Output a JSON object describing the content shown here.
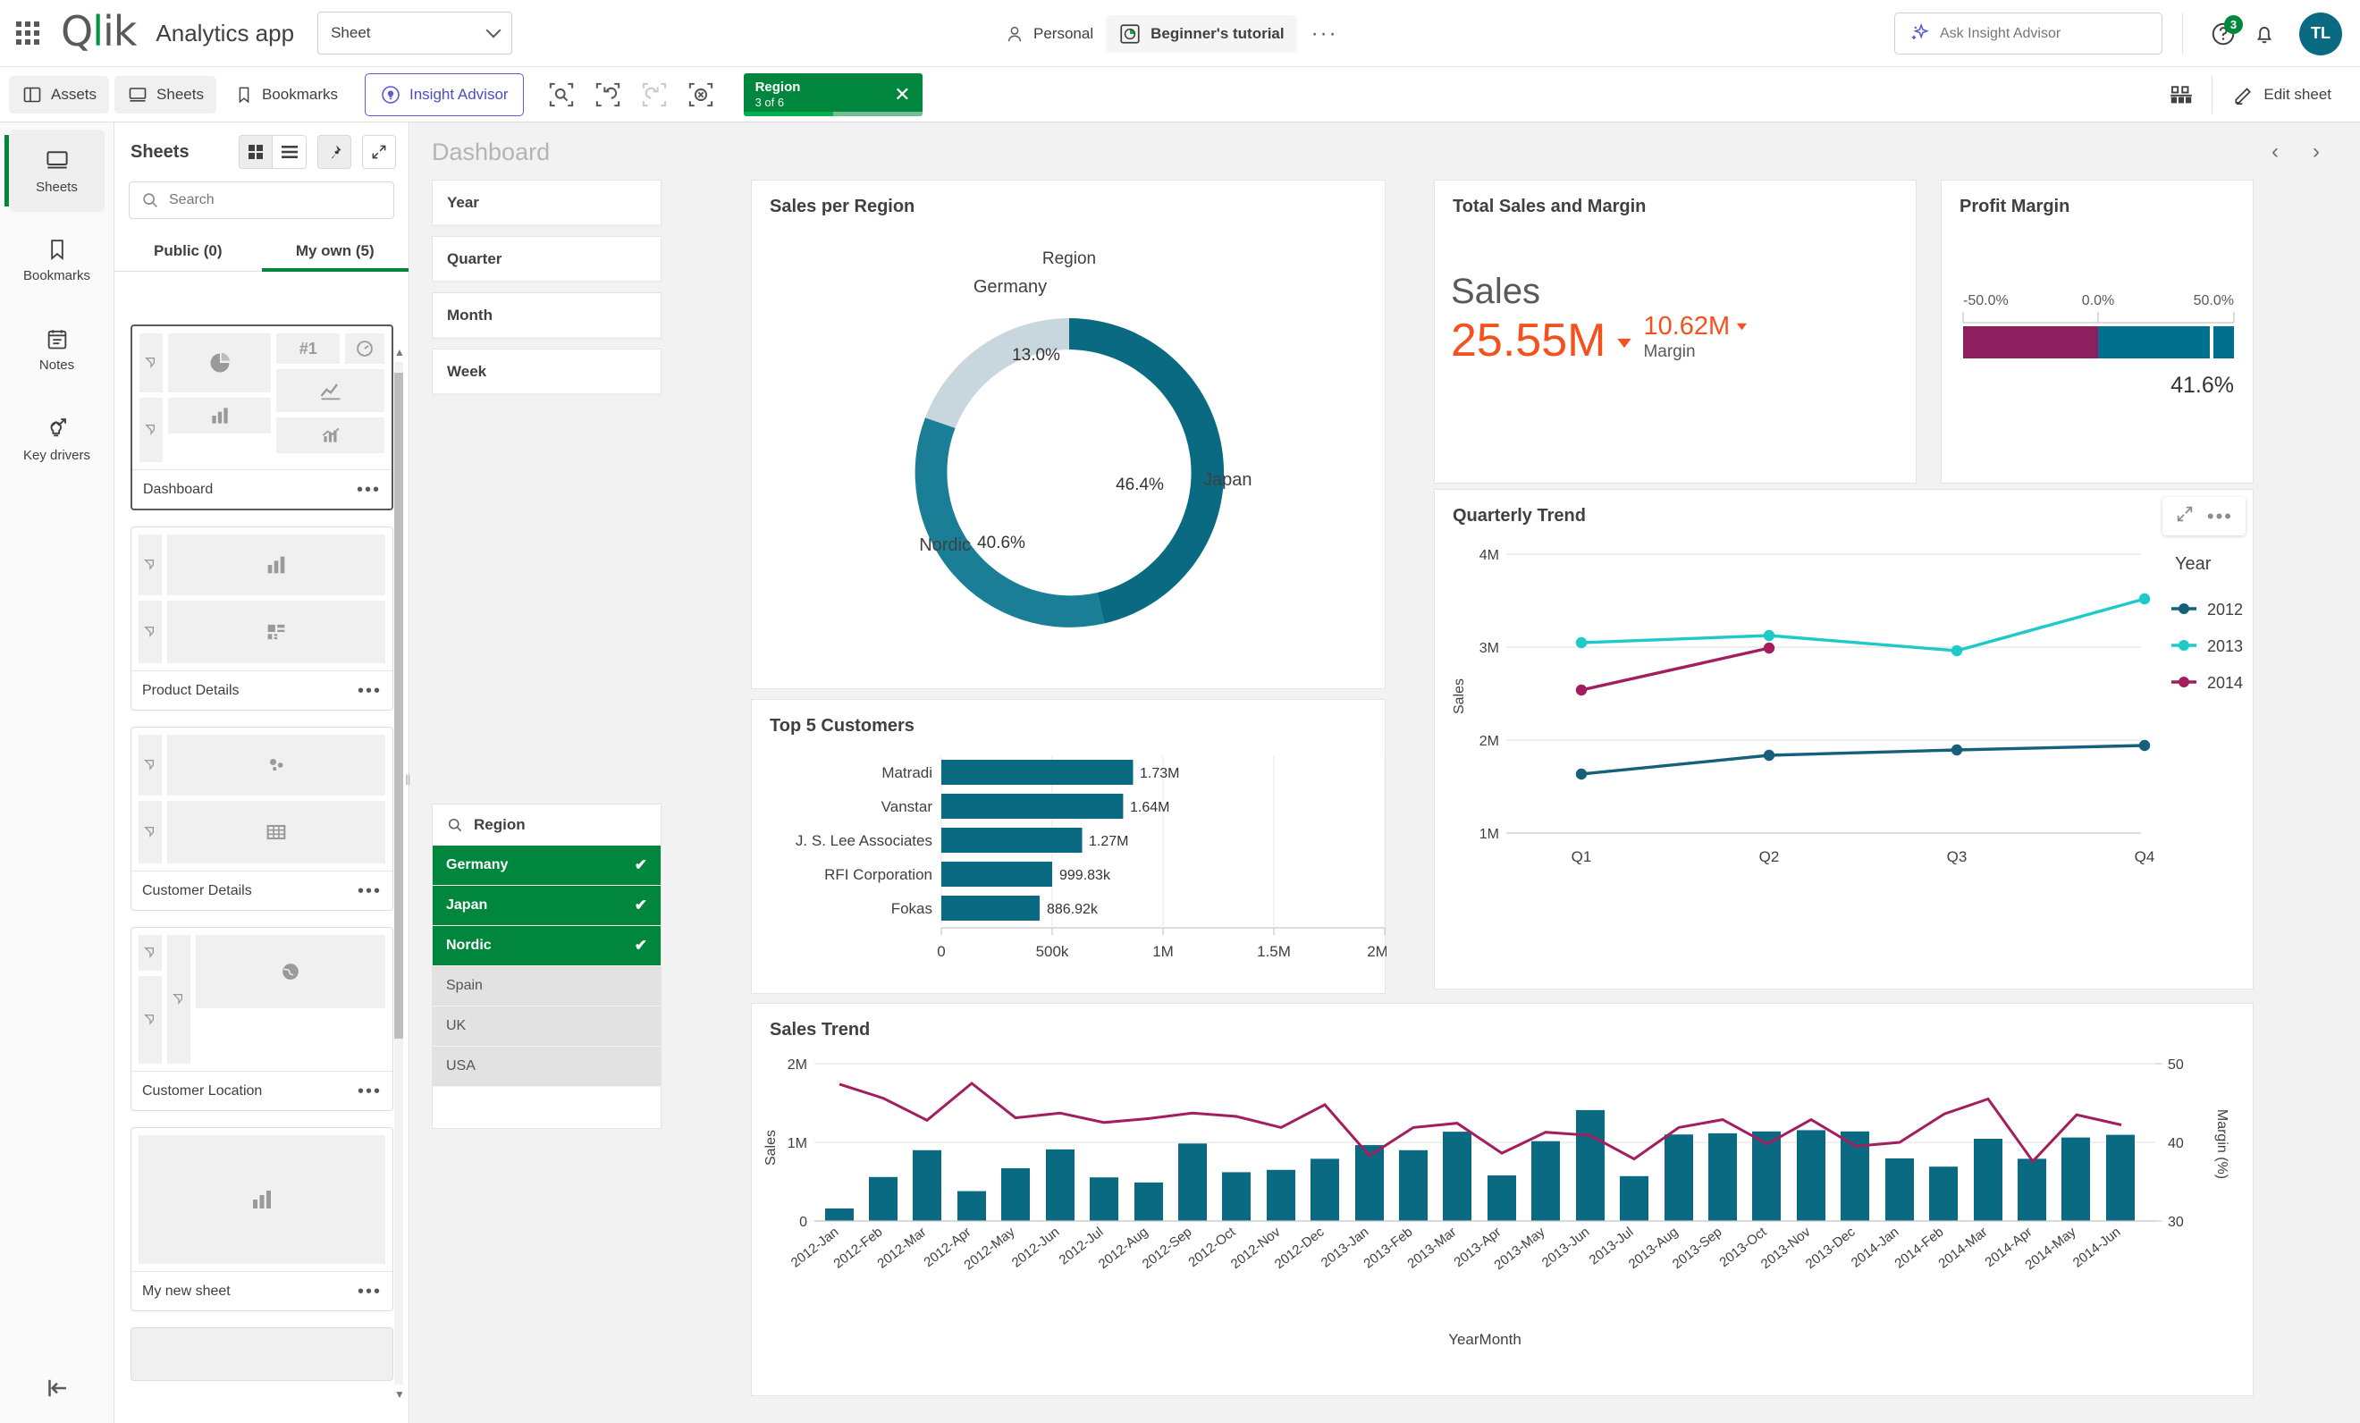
{
  "header": {
    "waffle_icon": "grid-apps-icon",
    "logo": "Qlik",
    "app_title": "Analytics app",
    "sheet_selector_label": "Sheet",
    "space_label": "Personal",
    "app_name": "Beginner's tutorial",
    "more_label": "···",
    "ask_placeholder": "Ask Insight Advisor",
    "help_badge": "3",
    "avatar_initials": "TL"
  },
  "toolbar": {
    "assets": "Assets",
    "sheets": "Sheets",
    "bookmarks": "Bookmarks",
    "insight_advisor": "Insight Advisor",
    "selection_chip": {
      "field": "Region",
      "state": "3 of 6",
      "close": "✕"
    },
    "sheet_view": "sheet-grid-icon",
    "edit_sheet": "Edit sheet"
  },
  "rail": {
    "items": [
      {
        "label": "Sheets",
        "icon": "sheet-icon",
        "selected": true
      },
      {
        "label": "Bookmarks",
        "icon": "bookmark-icon",
        "selected": false
      },
      {
        "label": "Notes",
        "icon": "notes-icon",
        "selected": false
      },
      {
        "label": "Key drivers",
        "icon": "key-drivers-icon",
        "selected": false
      }
    ],
    "collapse_icon": "collapse-left-icon"
  },
  "sheets_panel": {
    "title": "Sheets",
    "search_placeholder": "Search",
    "tabs": [
      {
        "label": "Public (0)",
        "active": false
      },
      {
        "label": "My own (5)",
        "active": true
      }
    ],
    "cards": [
      {
        "name": "Dashboard",
        "selected": true
      },
      {
        "name": "Product Details",
        "selected": false
      },
      {
        "name": "Customer Details",
        "selected": false
      },
      {
        "name": "Customer Location",
        "selected": false
      },
      {
        "name": "My new sheet",
        "selected": false
      }
    ]
  },
  "sheet": {
    "title": "Dashboard",
    "prev_icon": "chevron-left-icon",
    "next_icon": "chevron-right-icon"
  },
  "filters": {
    "boxes": [
      "Year",
      "Quarter",
      "Month",
      "Week"
    ],
    "listbox": {
      "field": "Region",
      "values": [
        {
          "label": "Germany",
          "state": "selected"
        },
        {
          "label": "Japan",
          "state": "selected"
        },
        {
          "label": "Nordic",
          "state": "selected"
        },
        {
          "label": "Spain",
          "state": "excluded"
        },
        {
          "label": "UK",
          "state": "excluded"
        },
        {
          "label": "USA",
          "state": "excluded"
        }
      ]
    }
  },
  "colors": {
    "teal_dark": "#0a6a82",
    "teal": "#1a7f96",
    "teal_light": "#c8d6dd",
    "magenta": "#a21e5e",
    "cyan": "#1ec9c9",
    "navy": "#15607a",
    "green": "#00873d",
    "orange": "#f4511e"
  },
  "chart_data": [
    {
      "id": "sales-per-region",
      "type": "pie",
      "title": "Sales per Region",
      "legend_title": "Region",
      "labels": [
        "Japan",
        "Nordic",
        "Germany"
      ],
      "values": [
        46.4,
        40.6,
        13.0
      ],
      "value_labels": [
        "46.4%",
        "40.6%",
        "13.0%"
      ],
      "colors": [
        "#0a6a82",
        "#1a7f96",
        "#c8d6dd"
      ],
      "donut": true
    },
    {
      "id": "total-sales-and-margin",
      "type": "kpi",
      "title": "Total Sales and Margin",
      "items": [
        {
          "label": "Sales",
          "value": "25.55M",
          "trend": "down",
          "color": "#f4511e",
          "primary": true
        },
        {
          "label": "Margin",
          "value": "10.62M",
          "trend": "down",
          "color": "#f4511e",
          "primary": false
        }
      ]
    },
    {
      "id": "profit-margin",
      "type": "bullet",
      "title": "Profit Margin",
      "axis_ticks": [
        "-50.0%",
        "0.0%",
        "50.0%"
      ],
      "axis_min": -50.0,
      "axis_max": 50.0,
      "value": 41.6,
      "value_label": "41.6%",
      "negative_segment_color": "#8e1f5e",
      "positive_segment_color": "#00708f"
    },
    {
      "id": "top-5-customers",
      "type": "bar",
      "orientation": "horizontal",
      "title": "Top 5 Customers",
      "categories": [
        "Matradi",
        "Vanstar",
        "J. S. Lee Associates",
        "RFI Corporation",
        "Fokas"
      ],
      "values": [
        1730000,
        1640000,
        1270000,
        999830,
        886920
      ],
      "value_labels": [
        "1.73M",
        "1.64M",
        "1.27M",
        "999.83k",
        "886.92k"
      ],
      "xlim": [
        0,
        2000000
      ],
      "xticks": [
        "0",
        "500k",
        "1M",
        "1.5M",
        "2M"
      ],
      "bar_color": "#0a6a82"
    },
    {
      "id": "quarterly-trend",
      "type": "line",
      "title": "Quarterly Trend",
      "xlabel": "",
      "ylabel": "Sales",
      "categories": [
        "Q1",
        "Q2",
        "Q3",
        "Q4"
      ],
      "ylim": [
        1000000,
        4000000
      ],
      "yticks": [
        "1M",
        "2M",
        "3M",
        "4M"
      ],
      "legend_title": "Year",
      "legend_position": "right",
      "series": [
        {
          "name": "2012",
          "color": "#15607a",
          "values": [
            1560000,
            1870000,
            1940000,
            1990000
          ]
        },
        {
          "name": "2013",
          "color": "#1ec9c9",
          "values": [
            3050000,
            3130000,
            2970000,
            3520000
          ]
        },
        {
          "name": "2014",
          "color": "#a21e5e",
          "values": [
            2540000,
            2990000,
            null,
            null
          ]
        }
      ]
    },
    {
      "id": "sales-trend",
      "type": "bar",
      "title": "Sales Trend",
      "xlabel": "YearMonth",
      "ylabel": "Sales",
      "y2label": "Margin (%)",
      "ylim": [
        0,
        2000000
      ],
      "yticks": [
        "0",
        "1M",
        "2M"
      ],
      "y2lim": [
        30,
        50
      ],
      "y2ticks": [
        "30",
        "40",
        "50"
      ],
      "bar_color": "#0a6a82",
      "line_color": "#a21e5e",
      "categories": [
        "2012-Jan",
        "2012-Feb",
        "2012-Mar",
        "2012-Apr",
        "2012-May",
        "2012-Jun",
        "2012-Jul",
        "2012-Aug",
        "2012-Sep",
        "2012-Oct",
        "2012-Nov",
        "2012-Dec",
        "2013-Jan",
        "2013-Feb",
        "2013-Mar",
        "2013-Apr",
        "2013-May",
        "2013-Jun",
        "2013-Jul",
        "2013-Aug",
        "2013-Sep",
        "2013-Oct",
        "2013-Nov",
        "2013-Dec",
        "2014-Jan",
        "2014-Feb",
        "2014-Mar",
        "2014-Apr",
        "2014-May",
        "2014-Jun"
      ],
      "series": [
        {
          "name": "Sales",
          "type": "bar",
          "axis": "left",
          "values": [
            160000,
            560000,
            900000,
            380000,
            670000,
            910000,
            555000,
            490000,
            985000,
            620000,
            650000,
            790000,
            965000,
            900000,
            1135000,
            580000,
            1015000,
            1410000,
            570000,
            1100000,
            1115000,
            1140000,
            1155000,
            1140000,
            795000,
            690000,
            1045000,
            790000,
            1060000,
            1095000
          ]
        },
        {
          "name": "Margin (%)",
          "type": "line",
          "axis": "right",
          "values": [
            47.4,
            45.6,
            42.8,
            47.5,
            43.1,
            43.7,
            42.5,
            43.0,
            43.7,
            43.3,
            41.9,
            44.8,
            38.3,
            41.9,
            42.4,
            38.6,
            41.3,
            40.9,
            37.9,
            41.9,
            42.9,
            39.8,
            42.9,
            39.5,
            40.0,
            43.6,
            45.5,
            37.6,
            43.5,
            42.2
          ]
        }
      ]
    }
  ]
}
